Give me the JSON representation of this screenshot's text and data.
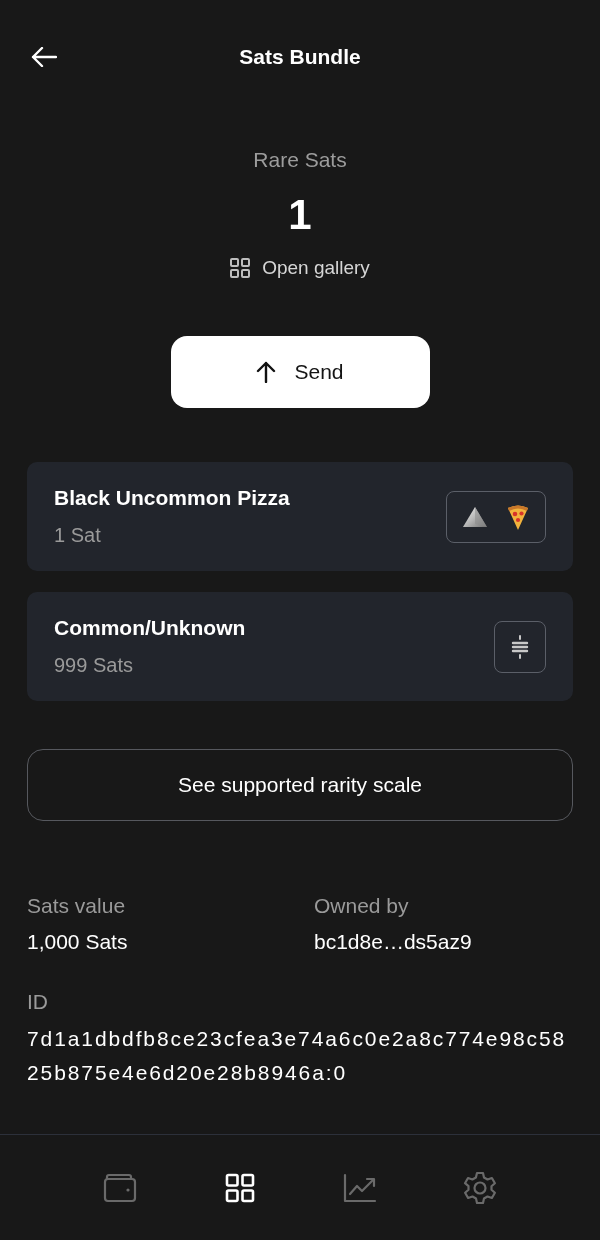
{
  "header": {
    "title": "Sats Bundle"
  },
  "summary": {
    "label": "Rare Sats",
    "count": "1",
    "gallery_link": "Open gallery"
  },
  "send_button": {
    "label": "Send"
  },
  "bundles": [
    {
      "name": "Black Uncommon Pizza",
      "amount": "1 Sat"
    },
    {
      "name": "Common/Unknown",
      "amount": "999 Sats"
    }
  ],
  "rarity_button": {
    "label": "See supported rarity scale"
  },
  "details": [
    {
      "label": "Sats value",
      "value": "1,000 Sats"
    },
    {
      "label": "Owned by",
      "value": "bc1d8e…ds5az9"
    }
  ],
  "id": {
    "label": "ID",
    "value": "7d1a1dbdfb8ce23cfea3e74a6c0e2a8c774e98c5825b875e4e6d20e28b8946a:0"
  },
  "nav": {
    "items": [
      {
        "selected": false
      },
      {
        "selected": true
      },
      {
        "selected": false
      },
      {
        "selected": false
      }
    ]
  }
}
